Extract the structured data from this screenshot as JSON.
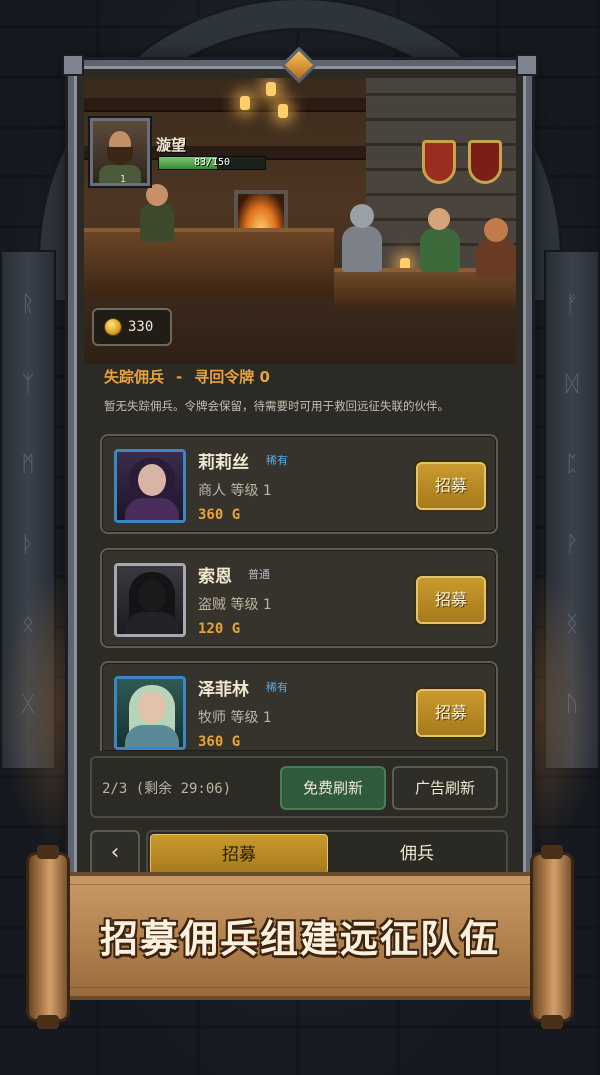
{
  "player": {
    "name": "漩望",
    "level": "1",
    "hp_text": "83/150",
    "hp_fraction": 0.55
  },
  "gold": {
    "amount": "330"
  },
  "quest": {
    "title": "失踪佣兵",
    "separator": "-",
    "subtitle": "寻回令牌 0",
    "description": "暂无失踪佣兵。令牌会保留，待需要时可用于救回远征失联的伙伴。"
  },
  "recruits": [
    {
      "name": "莉莉丝",
      "rarity": "稀有",
      "rarity_color": "#5aa8e0",
      "class_level": "商人  等级 1",
      "price": "360 G",
      "button": "招募"
    },
    {
      "name": "索恩",
      "rarity": "普通",
      "rarity_color": "#b8b8c4",
      "class_level": "盗贼  等级 1",
      "price": "120 G",
      "button": "招募"
    },
    {
      "name": "泽菲林",
      "rarity": "稀有",
      "rarity_color": "#5aa8e0",
      "class_level": "牧师  等级 1",
      "price": "360 G",
      "button": "招募"
    }
  ],
  "refresh": {
    "status": "2/3 (剩余 29:06)",
    "free_label": "免费刷新",
    "ad_label": "广告刷新"
  },
  "tabs": {
    "back_icon": "chevron-left-icon",
    "back_glyph": "‹",
    "recruit": "招募",
    "mercenary": "佣兵"
  },
  "banner": {
    "text": "招募佣兵组建远征队伍"
  },
  "colors": {
    "accent_gold": "#e9a33c",
    "button_gold": "#c99a2e",
    "rare_blue": "#3b86c4",
    "free_green": "#2f5a3c"
  }
}
